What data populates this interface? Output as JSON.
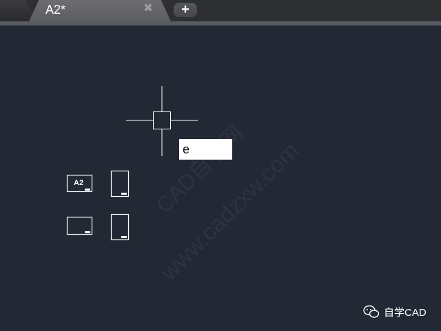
{
  "tab": {
    "title": "A2*",
    "close_glyph": "✖",
    "add_glyph": "+"
  },
  "command_input": {
    "value": "e"
  },
  "layout_icons": [
    {
      "name": "layout-icon-a2",
      "label": "A2",
      "orientation": "landscape"
    },
    {
      "name": "layout-icon-portrait-1",
      "orientation": "portrait"
    },
    {
      "name": "layout-icon-landscape-2",
      "orientation": "landscape"
    },
    {
      "name": "layout-icon-portrait-2",
      "orientation": "portrait"
    }
  ],
  "watermark": {
    "cn": "CAD自学网",
    "url": "www.cadzxw.com"
  },
  "brand": {
    "label": "自学CAD",
    "icon": "wechat-icon"
  },
  "colors": {
    "background": "#222834",
    "tab_active": "#5c5d62",
    "crosshair": "#ffffff"
  }
}
